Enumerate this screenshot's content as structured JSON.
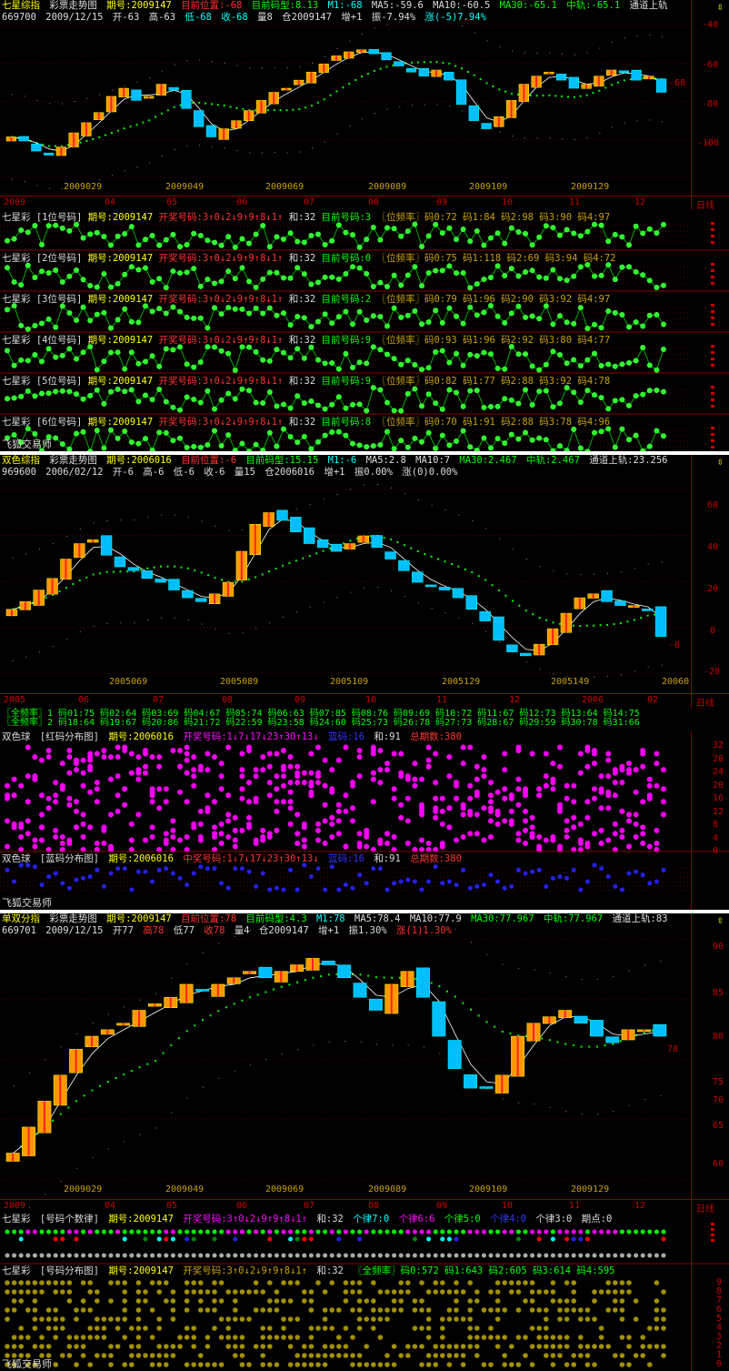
{
  "colors": {
    "yellow": "#ffff00",
    "green": "#00ff00",
    "red": "#ff3333",
    "cyan": "#00ffff",
    "magenta": "#ff00ff",
    "blue": "#3333ff",
    "olive": "#c8a000"
  },
  "p1": {
    "title": "七星综指",
    "subtitle": "彩票走势图",
    "qihao": "期号:2009147",
    "pos": "目前位置:-68",
    "mx": "目前码型:8.13",
    "m1": "M1:-68",
    "ma5": "MA5:-59.6",
    "ma10": "MA10:-60.5",
    "ma30": "MA30:-65.1",
    "mid": "中轨:-65.1",
    "upper": "通道上轨",
    "line2": {
      "code": "669700",
      "date": "2009/12/15",
      "open": "开-63",
      "high": "高-63",
      "low": "低-68",
      "close": "收-68",
      "vol": "量8",
      "pos2": "仓2009147",
      "inc": "增+1",
      "amp": "振-7.94%",
      "chg": "涨(-5)7.94%"
    },
    "yticks": [
      "-40",
      "-60",
      "-80",
      "-100"
    ],
    "lastval": "-68",
    "xdates": [
      "2009029",
      "2009049",
      "2009069",
      "2009089",
      "2009109",
      "2009129"
    ],
    "months": [
      "2009",
      "04",
      "05",
      "06",
      "07",
      "08",
      "09",
      "10",
      "11",
      "12"
    ],
    "period": "日线"
  },
  "p1rows": [
    {
      "name": "七星彩",
      "sub": "[1位号码]",
      "qh": "期号:2009147",
      "kj": "开奖号码:3↑0↓2↓9↑9↑8↓1↑",
      "he": "和:32",
      "cur": "目前号码:3",
      "freq": "〖位频率〗码0:72 码1:84 码2:98 码3:90 码4:97"
    },
    {
      "name": "七星彩",
      "sub": "[2位号码]",
      "qh": "期号:2009147",
      "kj": "开奖号码:3↑0↓2↓9↑9↑8↓1↑",
      "he": "和:32",
      "cur": "目前号码:0",
      "freq": "〖位频率〗码0:75 码1:118 码2:69 码3:94 码4:72"
    },
    {
      "name": "七星彩",
      "sub": "[3位号码]",
      "qh": "期号:2009147",
      "kj": "开奖号码:3↑0↓2↓9↑9↑8↓1↑",
      "he": "和:32",
      "cur": "目前号码:2",
      "freq": "〖位频率〗码0:79 码1:96 码2:90 码3:92 码4:97"
    },
    {
      "name": "七星彩",
      "sub": "[4位号码]",
      "qh": "期号:2009147",
      "kj": "开奖号码:3↑0↓2↓9↑9↑8↓1↑",
      "he": "和:32",
      "cur": "目前号码:9",
      "freq": "〖位频率〗码0:93 码1:96 码2:92 码3:80 码4:77"
    },
    {
      "name": "七星彩",
      "sub": "[5位号码]",
      "qh": "期号:2009147",
      "kj": "开奖号码:3↑0↓2↓9↑9↑8↓1↑",
      "he": "和:32",
      "cur": "目前号码:9",
      "freq": "〖位频率〗码0:82 码1:77 码2:88 码3:92 码4:78"
    },
    {
      "name": "七星彩",
      "sub": "[6位号码]",
      "qh": "期号:2009147",
      "kj": "开奖号码:3↑0↓2↓9↑9↑8↓1↑",
      "he": "和:32",
      "cur": "目前号码:8",
      "freq": "〖位频率〗码0:70 码1:91 码2:88 码3:78 码4:96"
    }
  ],
  "brand": "飞狐交易师",
  "p2": {
    "title": "双色综指",
    "subtitle": "彩票走势图",
    "qihao": "期号:2006016",
    "pos": "目前位置:-6",
    "mx": "目前码型:15.15",
    "m1": "M1:-6",
    "ma5": "MA5:2.8",
    "ma10": "MA10:7",
    "ma30": "MA30:2.467",
    "mid": "中轨:2.467",
    "upper": "通道上轨:23.256",
    "line2": {
      "code": "969600",
      "date": "2006/02/12",
      "open": "开-6",
      "high": "高-6",
      "low": "低-6",
      "close": "收-6",
      "vol": "量15",
      "pos2": "仓2006016",
      "inc": "增+1",
      "amp": "振0.00%",
      "chg": "涨(0)0.00%"
    },
    "yticks": [
      "60",
      "40",
      "20",
      "0",
      "-20"
    ],
    "lastval": "-6",
    "xdates": [
      "2005069",
      "2005089",
      "2005109",
      "2005129",
      "2005149",
      "20060"
    ],
    "months": [
      "2005",
      "06",
      "07",
      "08",
      "09",
      "10",
      "11",
      "12",
      "2006",
      "02"
    ],
    "period": "日线",
    "freq1": "〖全频率〗1 码01:75 码02:64 码03:69 码04:67 码05:74 码06:63 码07:85 码08:76 码09:69 码10:72 码11:67 码12:73 码13:64 码14:75",
    "freq2": "〖全频率〗2 码18:64 码19:67 码20:86 码21:72 码22:59 码23:58 码24:60 码25:73 码26:78 码27:73 码28:67 码29:59 码30:78 码31:66",
    "red": {
      "name": "双色球",
      "sub": "[红码分布图]",
      "qh": "期号:2006016",
      "kj": "开奖号码:1↓7↓17↓23↑30↑13↓",
      "blue": "蓝码:16",
      "he": "和:91",
      "total": "总期数:380",
      "yticks": [
        "32",
        "28",
        "24",
        "20",
        "16",
        "12",
        "8",
        "4",
        "0"
      ]
    },
    "bluepanel": {
      "name": "双色球",
      "sub": "[蓝码分布图]",
      "qh": "期号:2006016",
      "kj": "中奖号码:1↓7↓17↓23↑30↑13↓",
      "blue": "蓝码:16",
      "he": "和:91",
      "total": "总期数:380"
    }
  },
  "p3": {
    "title": "单双分指",
    "subtitle": "彩票走势图",
    "qihao": "期号:2009147",
    "pos": "目前位置:78",
    "mx": "目前码型:4.3",
    "m1": "M1:78",
    "ma5": "MA5:78.4",
    "ma10": "MA10:77.9",
    "ma30": "MA30:77.967",
    "mid": "中轨:77.967",
    "upper": "通道上轨:83",
    "line2": {
      "code": "669701",
      "date": "2009/12/15",
      "open": "开77",
      "high": "高78",
      "low": "低77",
      "close": "收78",
      "vol": "量4",
      "pos2": "仓2009147",
      "inc": "增+1",
      "amp": "振1.30%",
      "chg": "涨(1)1.30%"
    },
    "yticks": [
      "90",
      "85",
      "80",
      "75",
      "70",
      "65",
      "60"
    ],
    "lastval": "78",
    "xdates": [
      "2009029",
      "2009049",
      "2009069",
      "2009089",
      "2009109",
      "2009129"
    ],
    "months": [
      "2009",
      "04",
      "05",
      "06",
      "07",
      "08",
      "09",
      "10",
      "11",
      "12"
    ],
    "period": "日线",
    "rowA": {
      "name": "七星彩",
      "sub": "[号码个数律]",
      "qh": "期号:2009147",
      "kj": "开奖号码:3↑0↓2↓9↑9↑8↓1↑",
      "he": "和:32",
      "a": "个律7:0",
      "b": "个律6:6",
      "c": "个律5:0",
      "d": "个律4:0",
      "e": "个律3:0",
      "f": "期点:0"
    },
    "rowB": {
      "name": "七星彩",
      "sub": "[号码分布图]",
      "qh": "期号:2009147",
      "kj": "开奖号码:3↑0↓2↓9↑9↑8↓1↑",
      "he": "和:32",
      "freq": "〖全频率〗码0:572 码1:643 码2:605 码3:614 码4:595"
    },
    "digits": [
      "9",
      "8",
      "7",
      "6",
      "5",
      "4",
      "3",
      "2",
      "1",
      "0"
    ]
  },
  "chart_data": [
    {
      "type": "candlestick",
      "title": "七星综指",
      "series": [
        {
          "name": "七星综指",
          "values": [
            -90,
            -92,
            -97,
            -99,
            -95,
            -88,
            -83,
            -78,
            -70,
            -66,
            -72,
            -70,
            -64,
            -67,
            -76,
            -85,
            -90,
            -86,
            -82,
            -77,
            -72,
            -68,
            -66,
            -62,
            -58,
            -54,
            -50,
            -48,
            -47,
            -49,
            -52,
            -55,
            -58,
            -60,
            -57,
            -62,
            -74,
            -82,
            -86,
            -80,
            -72,
            -64,
            -60,
            -58,
            -62,
            -66,
            -64,
            -60,
            -57,
            -58,
            -62,
            -60,
            -68
          ]
        }
      ],
      "ylim": [
        -110,
        -35
      ]
    },
    {
      "type": "candlestick",
      "title": "双色综指",
      "series": [
        {
          "name": "双色综指",
          "values": [
            8,
            12,
            18,
            24,
            34,
            42,
            44,
            36,
            30,
            28,
            24,
            22,
            18,
            14,
            12,
            16,
            22,
            38,
            52,
            58,
            54,
            48,
            42,
            40,
            38,
            42,
            46,
            40,
            34,
            28,
            22,
            20,
            18,
            14,
            8,
            2,
            -8,
            -14,
            -16,
            -10,
            -2,
            6,
            14,
            16,
            12,
            10,
            10,
            8,
            -6
          ]
        }
      ],
      "ylim": [
        -25,
        70
      ]
    },
    {
      "type": "candlestick",
      "title": "单双分指",
      "series": [
        {
          "name": "单双分指",
          "values": [
            60,
            64,
            68,
            72,
            76,
            78,
            79,
            80,
            82,
            83,
            84,
            86,
            85,
            86,
            87,
            88,
            87,
            88,
            89,
            90,
            89,
            87,
            84,
            82,
            86,
            88,
            84,
            78,
            73,
            70,
            70,
            72,
            78,
            80,
            81,
            82,
            80,
            78,
            77,
            79,
            79,
            78
          ]
        }
      ],
      "ylim": [
        56,
        93
      ]
    }
  ]
}
